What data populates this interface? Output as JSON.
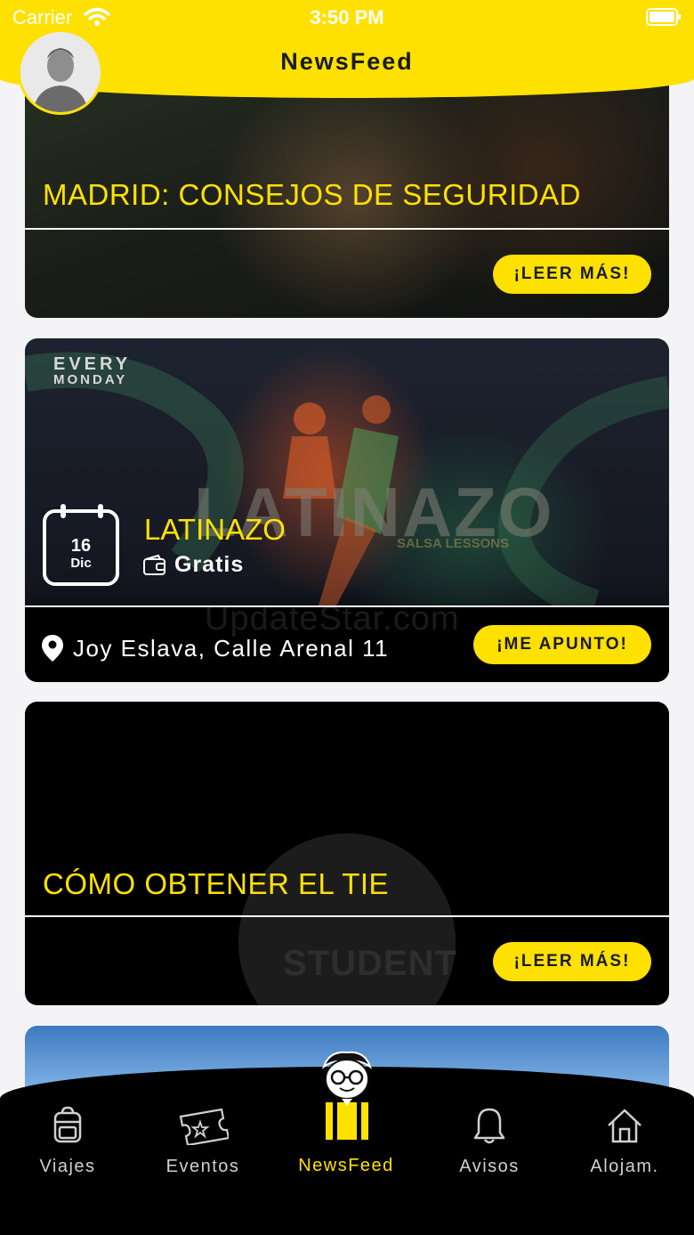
{
  "status_bar": {
    "carrier": "Carrier",
    "time": "3:50 PM"
  },
  "header": {
    "title": "NewsFeed"
  },
  "cards": [
    {
      "title": "MADRID: CONSEJOS DE SEGURIDAD",
      "button": "¡LEER MÁS!"
    },
    {
      "overlay_line1": "EVERY",
      "overlay_line2": "MONDAY",
      "overlay_brand": "LATINAZO",
      "overlay_sub": "SALSA LESSONS",
      "date_day": "16",
      "date_month": "Dic",
      "name": "LATINAZO",
      "price": "Gratis",
      "location": "Joy Eslava, Calle Arenal 11",
      "button": "¡ME APUNTO!"
    },
    {
      "title": "CÓMO OBTENER EL TIE",
      "logo_text": "STUDENT",
      "button": "¡LEER MÁS!"
    }
  ],
  "watermark": "UpdateStar.com",
  "tabs": [
    {
      "label": "Viajes",
      "icon": "backpack-icon"
    },
    {
      "label": "Eventos",
      "icon": "ticket-icon"
    },
    {
      "label": "NewsFeed",
      "icon": "mascot-icon",
      "active": true
    },
    {
      "label": "Avisos",
      "icon": "bell-icon"
    },
    {
      "label": "Alojam.",
      "icon": "house-icon"
    }
  ],
  "colors": {
    "accent": "#ffe100",
    "background": "#f4f4f6",
    "card_dark": "#000000"
  }
}
